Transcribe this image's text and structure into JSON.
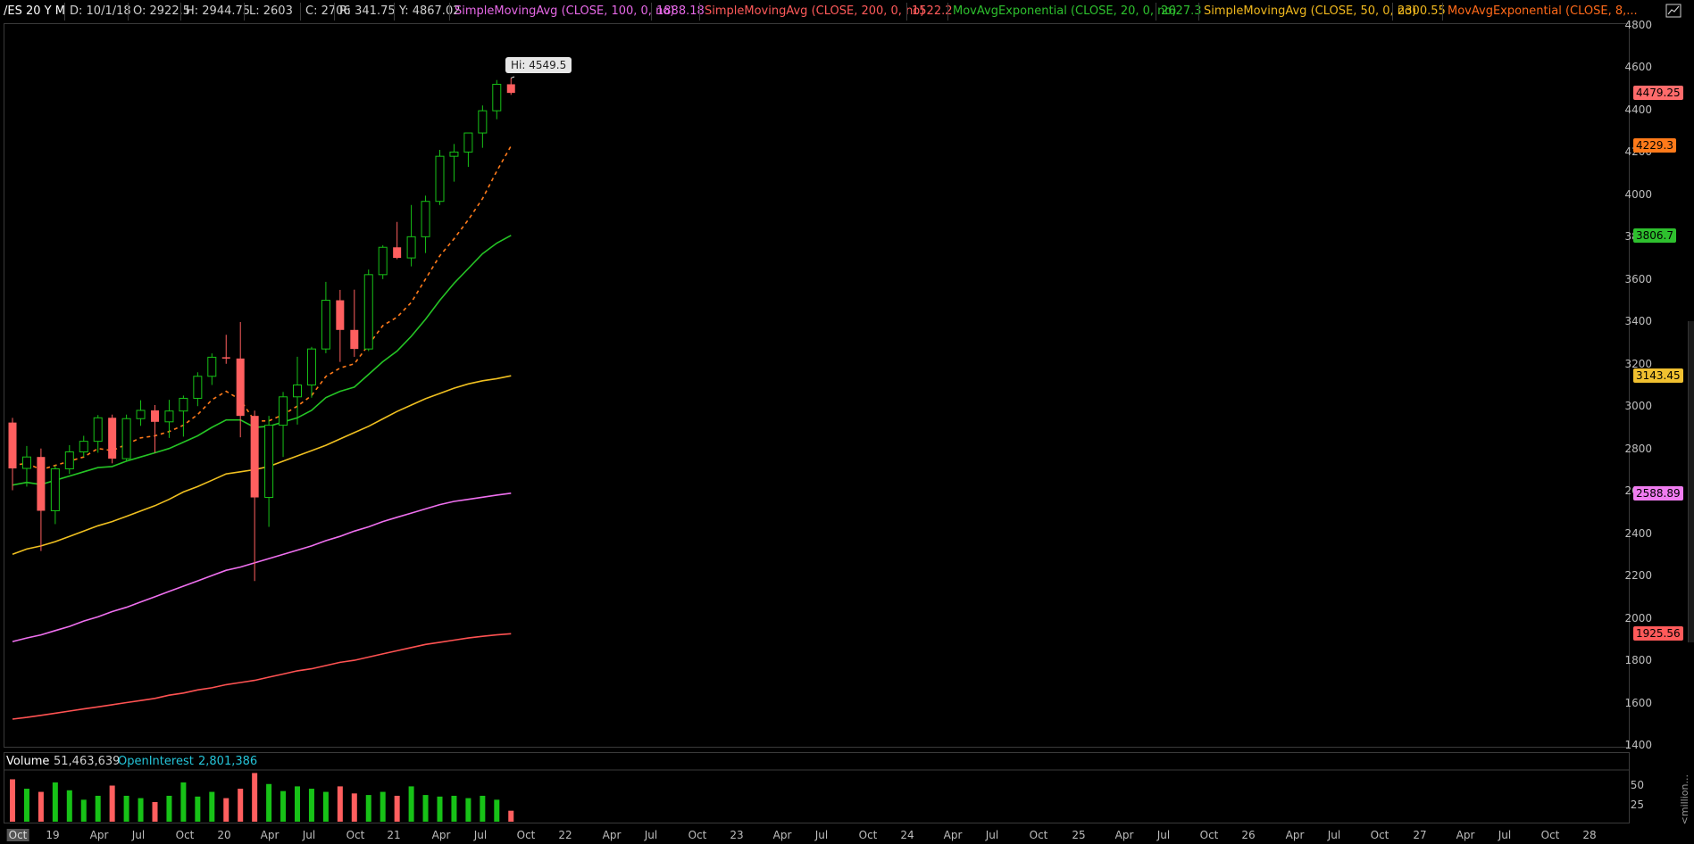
{
  "header": {
    "symbol": "/ES 20 Y M",
    "date": "D: 10/1/18",
    "open": "O: 2922.5",
    "high": "H: 2944.75",
    "low": "L: 2603",
    "close": "C: 2706",
    "range": "R: 341.75",
    "y": "Y: 4867.02",
    "studies": [
      {
        "label": "SimpleMovingAvg (CLOSE, 100, 0, no)",
        "value": "1888.18",
        "color": "#e668e6"
      },
      {
        "label": "SimpleMovingAvg (CLOSE, 200, 0, no)",
        "value": "1522.2",
        "color": "#ff5a5a"
      },
      {
        "label": "MovAvgExponential (CLOSE, 20, 0, no)",
        "value": "2627.3",
        "color": "#2ec02e"
      },
      {
        "label": "SimpleMovingAvg (CLOSE, 50, 0, no)",
        "value": "2300.55",
        "color": "#f0b81e"
      },
      {
        "label": "MovAvgExponential (CLOSE, 8,...",
        "value": "",
        "color": "#ff6a1a"
      }
    ]
  },
  "tooltip": "Hi: 4549.5",
  "price_axis": [
    "4800",
    "4600",
    "4400",
    "4200",
    "4000",
    "3800",
    "3600",
    "3400",
    "3200",
    "3000",
    "2800",
    "2600",
    "2400",
    "2200",
    "2000",
    "1800",
    "1600",
    "1400"
  ],
  "price_badges": [
    {
      "value": "4479.25",
      "color": "#ff6b6b"
    },
    {
      "value": "4229.3",
      "color": "#ff7a1a"
    },
    {
      "value": "3806.7",
      "color": "#2ec02e"
    },
    {
      "value": "3143.45",
      "color": "#f0c030"
    },
    {
      "value": "2588.89",
      "color": "#f07cf0"
    },
    {
      "value": "1925.56",
      "color": "#ff5a5a"
    }
  ],
  "volume": {
    "label": "Volume",
    "value": "51,463,639",
    "oi_label": "OpenInterest",
    "oi_value": "2,801,386",
    "axis": [
      "50",
      "25"
    ],
    "unit": "<million..."
  },
  "date_axis": [
    "Oct",
    "19",
    "Apr",
    "Jul",
    "Oct",
    "20",
    "Apr",
    "Jul",
    "Oct",
    "21",
    "Apr",
    "Jul",
    "Oct",
    "22",
    "Apr",
    "Jul",
    "Oct",
    "23",
    "Apr",
    "Jul",
    "Oct",
    "24",
    "Apr",
    "Jul",
    "Oct",
    "25",
    "Apr",
    "Jul",
    "Oct",
    "26",
    "Apr",
    "Jul",
    "Oct",
    "27",
    "Apr",
    "Jul",
    "Oct",
    "28"
  ],
  "chart_data": {
    "type": "candlestick",
    "interval": "1 month",
    "candles": [
      {
        "o": 2922.5,
        "h": 2944.75,
        "l": 2603,
        "c": 2706
      },
      {
        "o": 2706,
        "h": 2812,
        "l": 2620,
        "c": 2760
      },
      {
        "o": 2760,
        "h": 2800,
        "l": 2316,
        "c": 2506
      },
      {
        "o": 2506,
        "h": 2720,
        "l": 2443,
        "c": 2704
      },
      {
        "o": 2704,
        "h": 2816,
        "l": 2680,
        "c": 2784
      },
      {
        "o": 2784,
        "h": 2860,
        "l": 2760,
        "c": 2834
      },
      {
        "o": 2834,
        "h": 2958,
        "l": 2780,
        "c": 2945
      },
      {
        "o": 2945,
        "h": 2960,
        "l": 2730,
        "c": 2752
      },
      {
        "o": 2752,
        "h": 2960,
        "l": 2740,
        "c": 2941
      },
      {
        "o": 2941,
        "h": 3028,
        "l": 2907,
        "c": 2980
      },
      {
        "o": 2980,
        "h": 3005,
        "l": 2780,
        "c": 2926
      },
      {
        "o": 2926,
        "h": 3030,
        "l": 2850,
        "c": 2977
      },
      {
        "o": 2977,
        "h": 3050,
        "l": 2856,
        "c": 3037
      },
      {
        "o": 3037,
        "h": 3160,
        "l": 3000,
        "c": 3141
      },
      {
        "o": 3141,
        "h": 3249,
        "l": 3100,
        "c": 3231
      },
      {
        "o": 3231,
        "h": 3337,
        "l": 3200,
        "c": 3225
      },
      {
        "o": 3225,
        "h": 3397,
        "l": 2853,
        "c": 2954
      },
      {
        "o": 2954,
        "h": 2979,
        "l": 2174,
        "c": 2569
      },
      {
        "o": 2569,
        "h": 2954,
        "l": 2430,
        "c": 2910
      },
      {
        "o": 2910,
        "h": 3067,
        "l": 2760,
        "c": 3044
      },
      {
        "o": 3044,
        "h": 3233,
        "l": 2913,
        "c": 3100
      },
      {
        "o": 3100,
        "h": 3280,
        "l": 3040,
        "c": 3270
      },
      {
        "o": 3270,
        "h": 3587,
        "l": 3250,
        "c": 3500
      },
      {
        "o": 3500,
        "h": 3549,
        "l": 3209,
        "c": 3360
      },
      {
        "o": 3360,
        "h": 3550,
        "l": 3233,
        "c": 3270
      },
      {
        "o": 3270,
        "h": 3645,
        "l": 3260,
        "c": 3621
      },
      {
        "o": 3621,
        "h": 3760,
        "l": 3600,
        "c": 3750
      },
      {
        "o": 3750,
        "h": 3870,
        "l": 3694,
        "c": 3700
      },
      {
        "o": 3700,
        "h": 3950,
        "l": 3660,
        "c": 3800
      },
      {
        "o": 3800,
        "h": 3994,
        "l": 3723,
        "c": 3967
      },
      {
        "o": 3967,
        "h": 4210,
        "l": 3950,
        "c": 4180
      },
      {
        "o": 4180,
        "h": 4238,
        "l": 4060,
        "c": 4200
      },
      {
        "o": 4200,
        "h": 4257,
        "l": 4130,
        "c": 4290
      },
      {
        "o": 4290,
        "h": 4420,
        "l": 4220,
        "c": 4395
      },
      {
        "o": 4395,
        "h": 4540,
        "l": 4355,
        "c": 4520
      },
      {
        "o": 4520,
        "h": 4549.5,
        "l": 4470,
        "c": 4479.25
      }
    ],
    "ema8": [
      2720,
      2730,
      2700,
      2720,
      2740,
      2760,
      2800,
      2790,
      2820,
      2850,
      2860,
      2880,
      2910,
      2960,
      3030,
      3070,
      3030,
      2930,
      2930,
      2960,
      3000,
      3050,
      3140,
      3180,
      3200,
      3290,
      3380,
      3420,
      3490,
      3600,
      3710,
      3790,
      3880,
      3980,
      4110,
      4229.3
    ],
    "ema20": [
      2627.3,
      2640,
      2630,
      2650,
      2670,
      2690,
      2710,
      2715,
      2740,
      2760,
      2780,
      2800,
      2830,
      2860,
      2900,
      2935,
      2935,
      2900,
      2905,
      2925,
      2945,
      2980,
      3040,
      3070,
      3090,
      3150,
      3210,
      3260,
      3330,
      3410,
      3500,
      3580,
      3650,
      3720,
      3770,
      3806.7
    ],
    "sma50": [
      2300.55,
      2325,
      2340,
      2360,
      2385,
      2410,
      2435,
      2455,
      2480,
      2505,
      2530,
      2560,
      2595,
      2620,
      2650,
      2680,
      2690,
      2700,
      2715,
      2740,
      2765,
      2790,
      2815,
      2845,
      2875,
      2905,
      2940,
      2975,
      3005,
      3035,
      3060,
      3085,
      3105,
      3120,
      3130,
      3143.45
    ],
    "sma100": [
      1888.18,
      1905,
      1920,
      1940,
      1960,
      1985,
      2005,
      2030,
      2050,
      2075,
      2100,
      2125,
      2150,
      2175,
      2200,
      2225,
      2240,
      2260,
      2280,
      2300,
      2320,
      2340,
      2365,
      2385,
      2410,
      2430,
      2455,
      2475,
      2495,
      2515,
      2535,
      2550,
      2560,
      2570,
      2580,
      2588.89
    ],
    "sma200": [
      1522.2,
      1530,
      1540,
      1550,
      1560,
      1570,
      1580,
      1590,
      1600,
      1610,
      1620,
      1635,
      1645,
      1660,
      1670,
      1685,
      1695,
      1705,
      1720,
      1735,
      1750,
      1760,
      1775,
      1790,
      1800,
      1815,
      1830,
      1845,
      1860,
      1875,
      1885,
      1895,
      1905,
      1913,
      1920,
      1925.56
    ],
    "volume_millions": [
      54,
      42,
      38,
      50,
      40,
      28,
      33,
      46,
      33,
      30,
      25,
      33,
      50,
      32,
      38,
      30,
      42,
      62,
      48,
      39,
      45,
      42,
      38,
      45,
      36,
      34,
      38,
      33,
      45,
      34,
      32,
      33,
      30,
      33,
      28,
      14
    ],
    "y_range": [
      1400,
      4800
    ]
  }
}
